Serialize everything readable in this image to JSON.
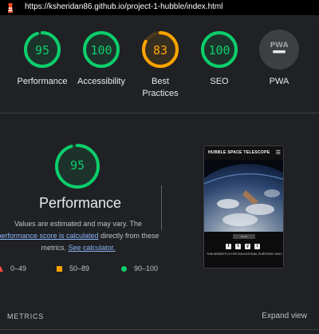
{
  "topbar": {
    "url": "https://ksheridan86.github.io/project-1-hubble/index.html",
    "logo_icon": "lighthouse-icon"
  },
  "gauges": [
    {
      "score": "95",
      "label": "Performance",
      "color": "#0cce6b",
      "fraction": 0.95,
      "name": "performance"
    },
    {
      "score": "100",
      "label": "Accessibility",
      "color": "#0cce6b",
      "fraction": 1.0,
      "name": "accessibility"
    },
    {
      "score": "83",
      "label": "Best Practices",
      "label_line1": "Best",
      "label_line2": "Practices",
      "color": "#ffa400",
      "fraction": 0.83,
      "name": "best-practices"
    },
    {
      "score": "100",
      "label": "SEO",
      "color": "#0cce6b",
      "fraction": 1.0,
      "name": "seo"
    },
    {
      "score": "",
      "label": "PWA",
      "badge": "PWA",
      "color": "#9aa0a6",
      "name": "pwa"
    }
  ],
  "performance": {
    "score": "95",
    "fraction": 0.95,
    "title": "Performance",
    "note_line1": "Values are estimated and may vary. The",
    "note_link1": "performance score is calculated",
    "note_after_link": " directly from these",
    "note_line3_prefix": "metrics. ",
    "note_link2": "See calculator."
  },
  "legend": {
    "fail": "0–49",
    "average": "50–89",
    "pass": "90–100",
    "colors": {
      "fail": "#ff4e42",
      "average": "#ffa400",
      "pass": "#0cce6b"
    }
  },
  "screenshot": {
    "site_title": "HUBBLE SPACE TELESCOPE",
    "menu_icon": "hamburger-icon",
    "tag": "Home",
    "social_icons": [
      "f",
      "t",
      "y",
      "i"
    ],
    "disclaimer": "THIS WEBSITE IS FOR EDUCATIONAL PURPOSES ONLY"
  },
  "footer": {
    "metrics_label": "METRICS",
    "expand_label": "Expand view"
  }
}
